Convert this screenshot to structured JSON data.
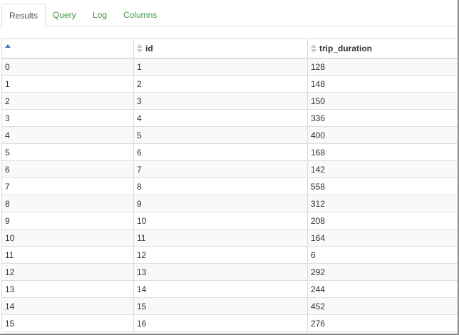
{
  "tabs": [
    {
      "label": "Results",
      "active": true
    },
    {
      "label": "Query",
      "active": false
    },
    {
      "label": "Log",
      "active": false
    },
    {
      "label": "Columns",
      "active": false
    }
  ],
  "table": {
    "columns": [
      {
        "label": "",
        "sort": "asc"
      },
      {
        "label": "id",
        "sort": "none"
      },
      {
        "label": "trip_duration",
        "sort": "none"
      }
    ],
    "rows": [
      [
        "0",
        "1",
        "128"
      ],
      [
        "1",
        "2",
        "148"
      ],
      [
        "2",
        "3",
        "150"
      ],
      [
        "3",
        "4",
        "336"
      ],
      [
        "4",
        "5",
        "400"
      ],
      [
        "5",
        "6",
        "168"
      ],
      [
        "6",
        "7",
        "142"
      ],
      [
        "7",
        "8",
        "558"
      ],
      [
        "8",
        "9",
        "312"
      ],
      [
        "9",
        "10",
        "208"
      ],
      [
        "10",
        "11",
        "164"
      ],
      [
        "11",
        "12",
        "6"
      ],
      [
        "12",
        "13",
        "292"
      ],
      [
        "13",
        "14",
        "244"
      ],
      [
        "14",
        "15",
        "452"
      ],
      [
        "15",
        "16",
        "276"
      ]
    ]
  },
  "colors": {
    "tab_link": "#3c9a3c",
    "sort_active": "#3a7bc0",
    "row_stripe": "#f9f9f9",
    "border": "#dddddd"
  }
}
